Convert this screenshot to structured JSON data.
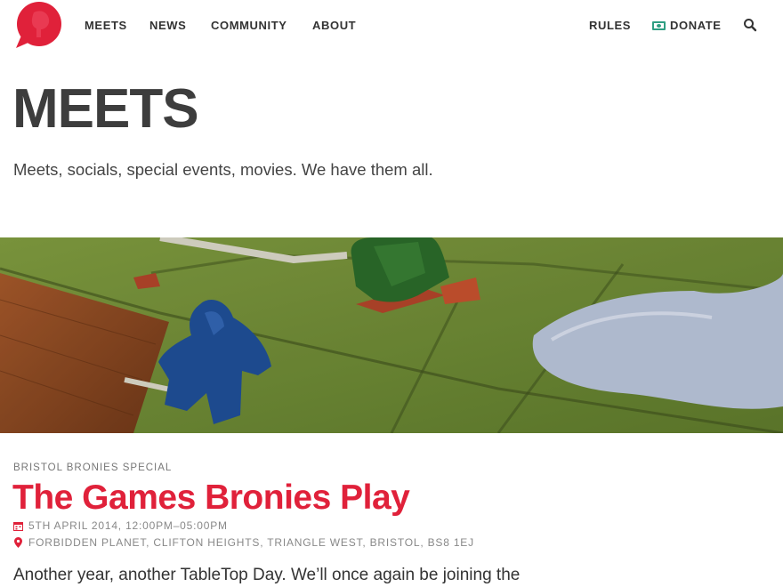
{
  "header": {
    "logo_icon": "speech-bubble-pony-logo",
    "nav": [
      "MEETS",
      "NEWS",
      "COMMUNITY",
      "ABOUT"
    ],
    "rules": "RULES",
    "donate": "DONATE",
    "donate_icon": "banknote-icon",
    "search_icon": "search-icon"
  },
  "page": {
    "title": "MEETS",
    "subtitle": "Meets, socials, special events, movies. We have them all."
  },
  "article": {
    "kicker": "BRISTOL BRONIES SPECIAL",
    "title": "The Games Bronies Play",
    "date_icon": "calendar-icon",
    "date": "5TH APRIL 2014, 12:00PM–05:00PM",
    "location_icon": "map-pin-icon",
    "location": "FORBIDDEN PLANET, CLIFTON HEIGHTS, TRIANGLE WEST, BRISTOL, BS8 1EJ",
    "excerpt": "Another year, another TableTop Day. We’ll once again be joining the"
  },
  "colors": {
    "brand_red": "#e0213a",
    "donate_green": "#2f9e82",
    "text_dark": "#3d3d3d"
  }
}
